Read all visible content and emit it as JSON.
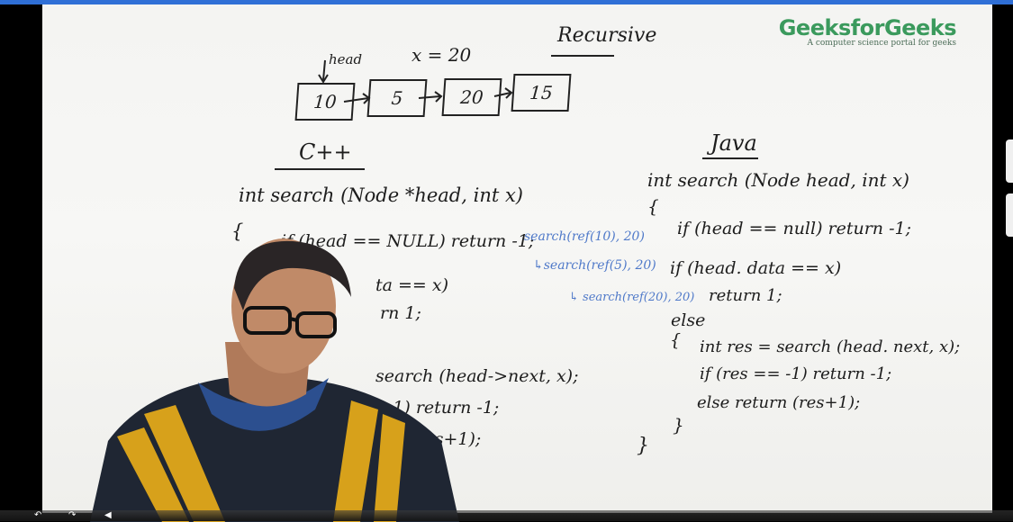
{
  "logo": {
    "title": "GeeksforGeeks",
    "subtitle": "A computer science portal for geeks"
  },
  "board": {
    "heading": "Recursive",
    "x_note": "x = 20",
    "head_label": "head",
    "nodes": [
      "10",
      "5",
      "20",
      "15"
    ],
    "cpp": {
      "title": "C++",
      "lines": [
        "int search (Node *head, int x)",
        "{",
        "if (head == NULL) return -1;",
        "ta == x)",
        "rn 1;",
        "search (head->next, x);",
        "== -1) return -1;",
        "(res+1);"
      ]
    },
    "trace": [
      "search(ref(10), 20)",
      "↳search(ref(5), 20)",
      "↳ search(ref(20), 20)"
    ],
    "java": {
      "title": "Java",
      "lines": [
        "int search (Node head, int x)",
        "{",
        "if (head == null) return -1;",
        "if (head. data == x)",
        "return 1;",
        "else",
        "{",
        "int res = search (head. next, x);",
        "if (res == -1) return -1;",
        "else return (res+1);",
        "}",
        "}"
      ]
    }
  }
}
